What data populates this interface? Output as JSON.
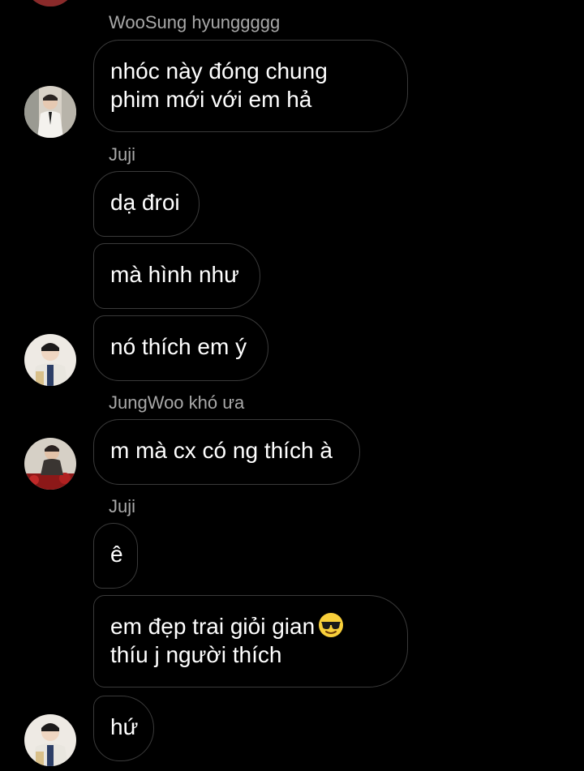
{
  "messages": [
    {
      "sender": "WooSung hyunggggg",
      "bubbles": [
        "nhóc này đóng chung",
        "phim mới với em hả"
      ]
    },
    {
      "sender": "Juji",
      "bubbles": [
        "dạ đroi",
        "mà hình như",
        "nó thích em ý"
      ]
    },
    {
      "sender": "JungWoo khó ưa",
      "bubbles": [
        "m mà cx có ng thích à"
      ]
    },
    {
      "sender": "Juji",
      "bubbles": [
        "ê",
        "em đẹp trai giỏi gian",
        "thíu j người thích",
        "hứ"
      ]
    }
  ],
  "emoji": "sunglasses-emoji",
  "colors": {
    "background": "#000000",
    "bubble_border": "#3a3a3a",
    "sender_text": "#a8a8a8",
    "message_text": "#ffffff"
  }
}
